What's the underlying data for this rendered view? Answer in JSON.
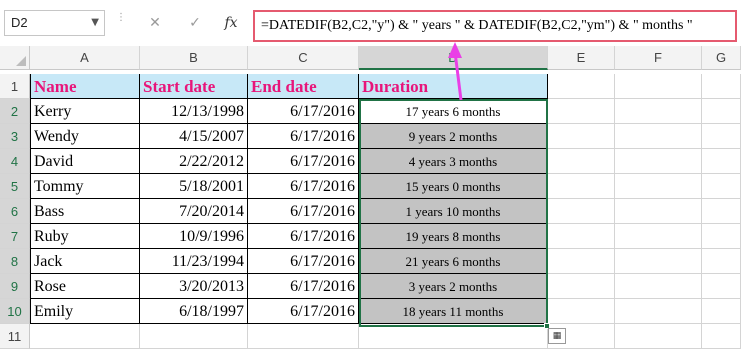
{
  "formula_bar": {
    "name_box": "D2",
    "name_box_arrow": "▼",
    "dots": "⋮",
    "cancel_icon": "✕",
    "enter_icon": "✓",
    "fx_label": "fx",
    "formula": "=DATEDIF(B2,C2,\"y\") & \" years \" & DATEDIF(B2,C2,\"ym\") & \" months \""
  },
  "columns": [
    "A",
    "B",
    "C",
    "D",
    "E",
    "F",
    "G"
  ],
  "row_numbers": [
    "1",
    "2",
    "3",
    "4",
    "5",
    "6",
    "7",
    "8",
    "9",
    "10",
    "11"
  ],
  "headers": {
    "name": "Name",
    "start_date": "Start date",
    "end_date": "End date",
    "duration": "Duration"
  },
  "rows": [
    {
      "name": "Kerry",
      "start": "12/13/1998",
      "end": "6/17/2016",
      "duration": "17 years 6 months"
    },
    {
      "name": "Wendy",
      "start": "4/15/2007",
      "end": "6/17/2016",
      "duration": "9 years 2 months"
    },
    {
      "name": "David",
      "start": "2/22/2012",
      "end": "6/17/2016",
      "duration": "4 years 3 months"
    },
    {
      "name": "Tommy",
      "start": "5/18/2001",
      "end": "6/17/2016",
      "duration": "15 years 0 months"
    },
    {
      "name": "Bass",
      "start": "7/20/2014",
      "end": "6/17/2016",
      "duration": "1 years 10 months"
    },
    {
      "name": "Ruby",
      "start": "10/9/1996",
      "end": "6/17/2016",
      "duration": "19 years 8 months"
    },
    {
      "name": "Jack",
      "start": "11/23/1994",
      "end": "6/17/2016",
      "duration": "21 years 6 months"
    },
    {
      "name": "Rose",
      "start": "3/20/2013",
      "end": "6/17/2016",
      "duration": "3 years 2 months"
    },
    {
      "name": "Emily",
      "start": "6/18/1997",
      "end": "6/17/2016",
      "duration": "18 years 11 months"
    }
  ],
  "quick_analysis_icon": "▦",
  "colors": {
    "header_fill": "#c7e8f7",
    "header_text": "#e8157a",
    "selection": "#217346",
    "selected_fill": "#c3c3c3",
    "formula_highlight": "#e55a6f",
    "arrow": "#ea3fe6"
  }
}
